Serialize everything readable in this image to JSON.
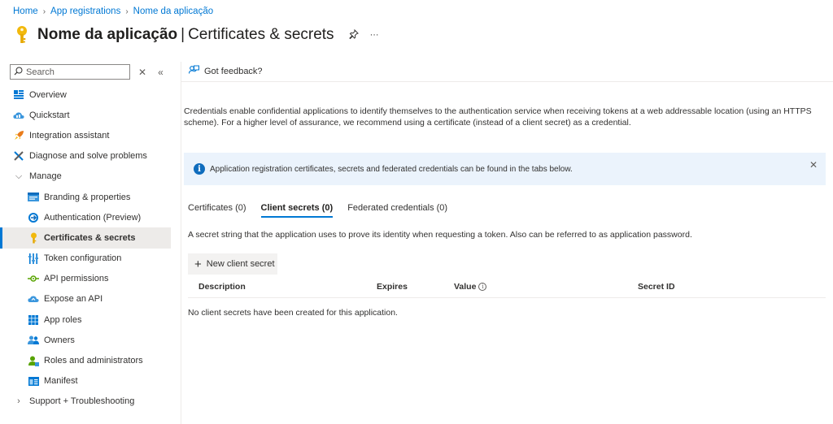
{
  "breadcrumb": {
    "items": [
      "Home",
      "App registrations",
      "Nome da aplicação"
    ]
  },
  "title": {
    "main": "Nome da aplicação",
    "separator": "|",
    "sub": "Certificates & secrets",
    "pin_icon": "pin-icon",
    "more": "···"
  },
  "sidebar": {
    "search_placeholder": "Search",
    "items": [
      {
        "label": "Overview",
        "icon": "overview-icon"
      },
      {
        "label": "Quickstart",
        "icon": "quickstart-icon"
      },
      {
        "label": "Integration assistant",
        "icon": "rocket-icon"
      },
      {
        "label": "Diagnose and solve problems",
        "icon": "wrench-icon"
      },
      {
        "label": "Manage",
        "icon": "chevron-down-icon"
      },
      {
        "label": "Branding & properties",
        "icon": "branding-icon"
      },
      {
        "label": "Authentication (Preview)",
        "icon": "authentication-icon"
      },
      {
        "label": "Certificates & secrets",
        "icon": "key-icon"
      },
      {
        "label": "Token configuration",
        "icon": "token-icon"
      },
      {
        "label": "API permissions",
        "icon": "api-permissions-icon"
      },
      {
        "label": "Expose an API",
        "icon": "cloud-icon"
      },
      {
        "label": "App roles",
        "icon": "app-roles-icon"
      },
      {
        "label": "Owners",
        "icon": "owners-icon"
      },
      {
        "label": "Roles and administrators",
        "icon": "roles-icon"
      },
      {
        "label": "Manifest",
        "icon": "manifest-icon"
      },
      {
        "label": "Support + Troubleshooting",
        "icon": "chevron-right-icon"
      }
    ]
  },
  "toolbar": {
    "feedback_label": "Got feedback?"
  },
  "main": {
    "description": "Credentials enable confidential applications to identify themselves to the authentication service when receiving tokens at a web addressable location (using an HTTPS scheme). For a higher level of assurance, we recommend using a certificate (instead of a client secret) as a credential.",
    "info_message": "Application registration certificates, secrets and federated credentials can be found in the tabs below.",
    "tabs": [
      {
        "label": "Certificates (0)"
      },
      {
        "label": "Client secrets (0)"
      },
      {
        "label": "Federated credentials (0)"
      }
    ],
    "secret_description": "A secret string that the application uses to prove its identity when requesting a token. Also can be referred to as application password.",
    "new_button_label": "New client secret",
    "table": {
      "columns": [
        "Description",
        "Expires",
        "Value",
        "Secret ID"
      ],
      "empty_message": "No client secrets have been created for this application."
    }
  },
  "colors": {
    "accent": "#0078d4",
    "info_bg": "#ebf3fc",
    "key_yellow": "#f2b90d"
  }
}
